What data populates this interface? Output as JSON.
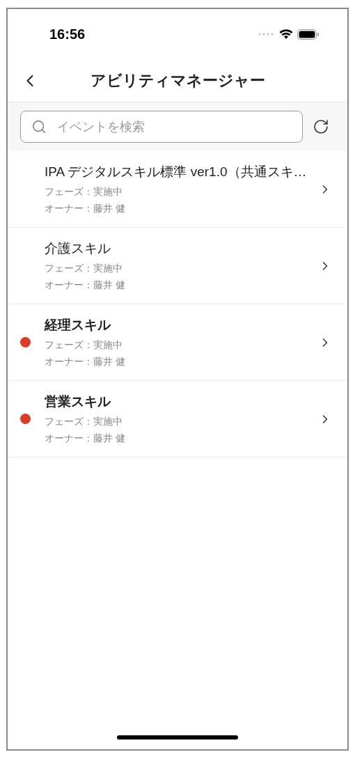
{
  "status_bar": {
    "time": "16:56"
  },
  "header": {
    "title": "アビリティマネージャー"
  },
  "search": {
    "placeholder": "イベントを検索"
  },
  "events": [
    {
      "title": "IPA デジタルスキル標準 ver1.0（共通スキ…",
      "phase": "フェーズ：実施中",
      "owner": "オーナー：藤井 健",
      "unread": false
    },
    {
      "title": "介護スキル",
      "phase": "フェーズ：実施中",
      "owner": "オーナー：藤井 健",
      "unread": false
    },
    {
      "title": "経理スキル",
      "phase": "フェーズ：実施中",
      "owner": "オーナー：藤井 健",
      "unread": true
    },
    {
      "title": "営業スキル",
      "phase": "フェーズ：実施中",
      "owner": "オーナー：藤井 健",
      "unread": true
    }
  ]
}
